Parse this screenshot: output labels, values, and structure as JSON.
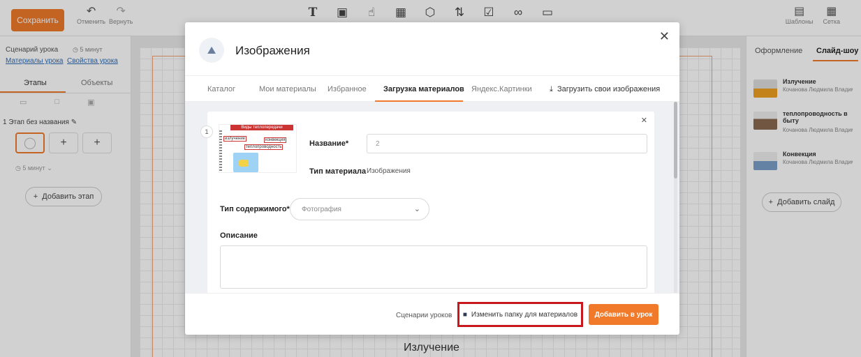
{
  "toolbar": {
    "save_label": "Сохранить",
    "undo_label": "Отменить",
    "redo_label": "Вернуть",
    "templates_label": "Шаблоны",
    "grid_label": "Сетка",
    "tools": [
      "text-tool-icon",
      "image-tool-icon",
      "interactive-tool-icon",
      "table-tool-icon",
      "3d-tool-icon",
      "sort-tool-icon",
      "test-tool-icon",
      "link-tool-icon",
      "page-tool-icon"
    ]
  },
  "left_panel": {
    "scenario_label": "Сценарий урока",
    "duration": "5 минут",
    "materials_link": "Материалы урока",
    "properties_link": "Свойства урока",
    "tabs": [
      "Этапы",
      "Объекты"
    ],
    "stage_title": "1 Этап без названия",
    "stage_duration": "5 минут",
    "add_stage": "Добавить этап"
  },
  "right_panel": {
    "tabs": [
      "Оформление",
      "Слайд-шоу"
    ],
    "slides": [
      {
        "name": "Излучение",
        "author": "Кочанова Людмила Владим..."
      },
      {
        "name": "теплопроводность в быту",
        "author": "Кочанова Людмила Владим..."
      },
      {
        "name": "Конвекция",
        "author": "Кочанова Людмила Владим..."
      }
    ],
    "add_slide": "Добавить слайд"
  },
  "canvas": {
    "title": "Излучение"
  },
  "modal": {
    "title": "Изображения",
    "tabs": [
      "Каталог",
      "Мои материалы",
      "Избранное",
      "Загрузка материалов",
      "Яндекс.Картинки"
    ],
    "upload_own": "Загрузить свои изображения",
    "card": {
      "number": "1",
      "preview": {
        "header": "Виды теплопередачи",
        "box1": "излучение",
        "box2": "конвекция",
        "box3": "теплопроводность"
      },
      "name_label": "Название*",
      "name_value": "2",
      "type_label": "Тип материала",
      "type_value": "Изображения",
      "content_type_label": "Тип содержимого*",
      "content_type_value": "Фотография",
      "description_label": "Описание"
    },
    "footer": {
      "scenarios_link": "Сценарии уроков",
      "change_folder": "Изменить папку для материалов",
      "add_to_lesson": "Добавить в урок"
    }
  }
}
